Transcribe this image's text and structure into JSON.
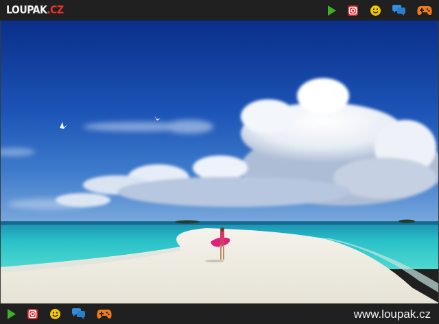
{
  "header": {
    "logo_main": "LOUPAK",
    "logo_tld": ".CZ",
    "icons": [
      "play-icon",
      "instagram-icon",
      "smiley-icon",
      "chat-icon",
      "gamepad-icon"
    ]
  },
  "footer": {
    "icons": [
      "play-icon",
      "instagram-icon",
      "smiley-icon",
      "chat-icon",
      "gamepad-icon"
    ],
    "site_url": "www.loupak.cz"
  },
  "colors": {
    "bar_background": "#202020",
    "play_green": "#3fae29",
    "instagram_red": "#d9292b",
    "smiley_yellow": "#f5c400",
    "chat_blue": "#2f8fe0",
    "gamepad_orange": "#f07a1a",
    "logo_red": "#e8322b"
  }
}
